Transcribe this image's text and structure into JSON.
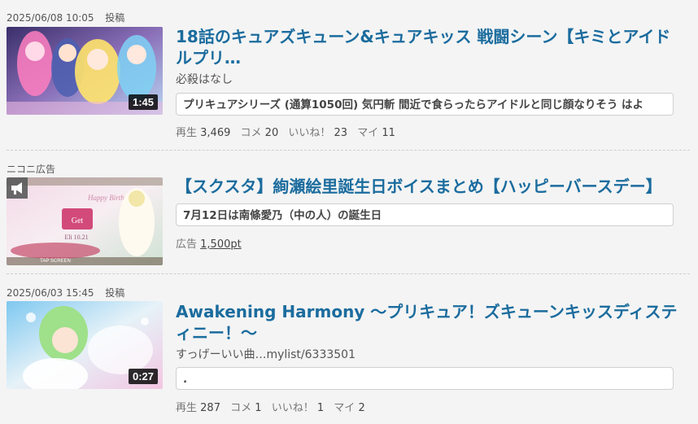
{
  "items": [
    {
      "posted_at": "2025/06/08 10:05",
      "posted_label": "投稿",
      "duration": "1:45",
      "title": "18話のキュアズキューン&キュアキッス 戦闘シーン【キミとアイドルプリ…",
      "description": "必殺はなし",
      "comment": "プリキュアシリーズ (通算1050回) 気円斬 間近で食らったらアイドルと同じ顔なりそう はよ",
      "stats": {
        "views_label": "再生",
        "views": "3,469",
        "comments_label": "コメ",
        "comments": "20",
        "likes_label": "いいね！",
        "likes": "23",
        "mylist_label": "マイ",
        "mylist": "11"
      }
    },
    {
      "ad_label": "ニコニ広告",
      "thumb_text": {
        "get": "Get",
        "date": "Eli 10.21",
        "tap": "TAP SCREEN",
        "banner": "Happy Birthday"
      },
      "title": "【スクスタ】絢瀬絵里誕生日ボイスまとめ【ハッピーバースデー】",
      "comment": "7月12日は南條愛乃（中の人）の誕生日",
      "ad_prefix": "広告",
      "ad_price": "1,500pt"
    },
    {
      "posted_at": "2025/06/03 15:45",
      "posted_label": "投稿",
      "duration": "0:27",
      "title": "Awakening Harmony ～プリキュア！ズキューンキッスディスティニー！～",
      "description": "すっげーいい曲…mylist/6333501",
      "comment": ".",
      "stats": {
        "views_label": "再生",
        "views": "287",
        "comments_label": "コメ",
        "comments": "1",
        "likes_label": "いいね！",
        "likes": "1",
        "mylist_label": "マイ",
        "mylist": "2"
      }
    }
  ],
  "colors": {
    "title": "#1b6c9e",
    "background": "#f4f4f4"
  },
  "icons": {
    "ad_megaphone": "megaphone-icon"
  }
}
